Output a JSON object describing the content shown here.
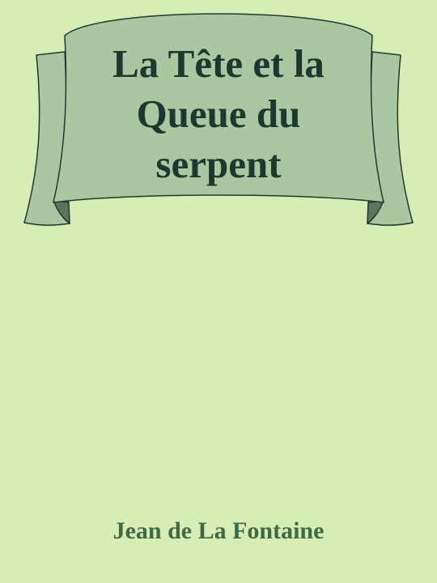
{
  "book": {
    "title_lines": [
      "La Tête et la",
      "Queue du",
      "serpent"
    ],
    "author": "Jean de La Fontaine"
  },
  "colors": {
    "background": "#d8ecb6",
    "banner_fill": "#a9c8a1",
    "banner_fold": "#5f735d",
    "banner_outline": "#1e3a30",
    "title_text": "#1b3a2f",
    "author_text": "#3e6b45"
  },
  "icons": {
    "banner": "scroll-ribbon-banner"
  }
}
